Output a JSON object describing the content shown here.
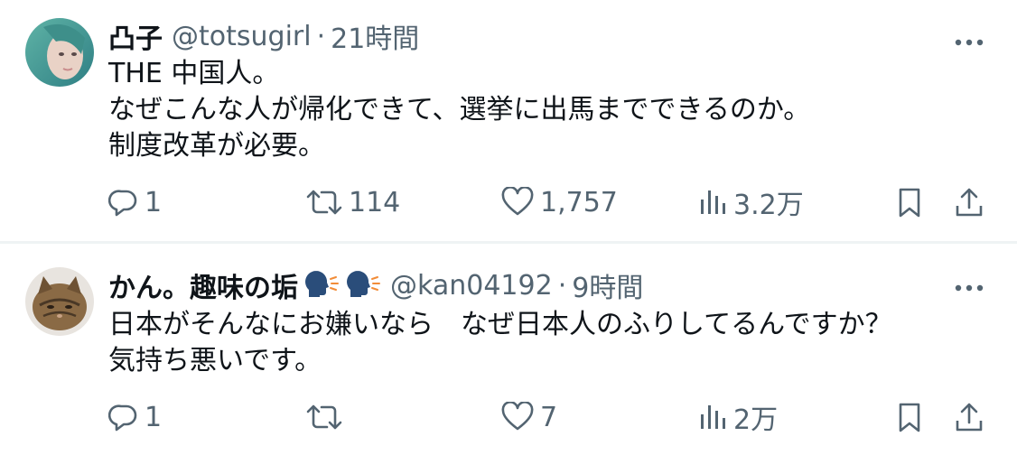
{
  "tweets": [
    {
      "name": "凸子",
      "handle": "@totsugirl",
      "separator": "·",
      "time": "21時間",
      "body": "THE 中国人。\nなぜこんな人が帰化できて、選挙に出馬までできるのか。\n制度改革が必要。",
      "replies": "1",
      "retweets": "114",
      "likes": "1,757",
      "views": "3.2万"
    },
    {
      "name": "かん。趣味の垢",
      "handle": "@kan04192",
      "separator": "·",
      "time": "9時間",
      "body": "日本がそんなにお嫌いなら　なぜ日本人のふりしてるんですか？\n気持ち悪いです。",
      "replies": "1",
      "retweets": "",
      "likes": "7",
      "views": "2万"
    }
  ],
  "icons": [
    "more-icon",
    "reply-icon",
    "retweet-icon",
    "like-icon",
    "views-icon",
    "bookmark-icon",
    "share-icon",
    "speaking-head-emoji"
  ],
  "colors": {
    "text": "#0f1419",
    "secondary": "#536471",
    "divider": "#eff3f4",
    "emoji_blue": "#2a4d7a"
  }
}
